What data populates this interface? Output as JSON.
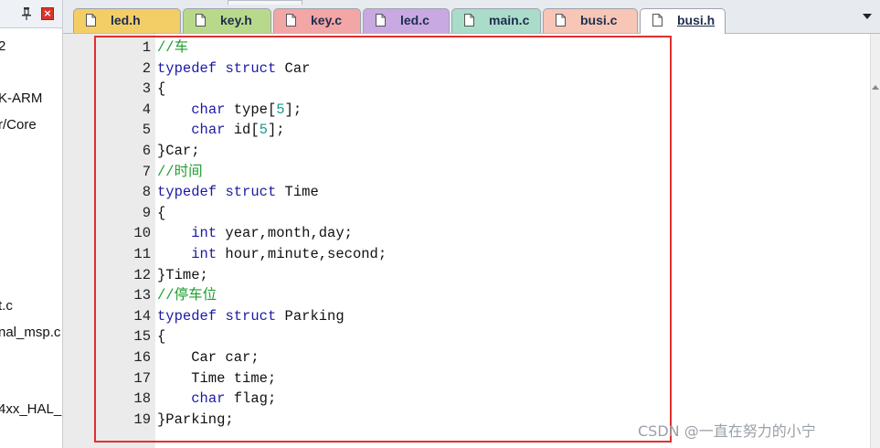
{
  "left_pane": {
    "items": [
      "2",
      "K-ARM",
      "r/Core",
      "t.c",
      "nal_msp.c",
      "4xx_HAL_"
    ]
  },
  "tabs": [
    {
      "label": "led.h",
      "color": "#f3ce67",
      "active": false
    },
    {
      "label": "key.h",
      "color": "#b9d98a",
      "active": false
    },
    {
      "label": "key.c",
      "color": "#f3a6a6",
      "active": false
    },
    {
      "label": "led.c",
      "color": "#c9a9e2",
      "active": false
    },
    {
      "label": "main.c",
      "color": "#a9dcc9",
      "active": false
    },
    {
      "label": "busi.c",
      "color": "#f7c6b6",
      "active": false
    },
    {
      "label": "busi.h",
      "color": "#ffffff",
      "active": true
    }
  ],
  "code_lines": [
    {
      "n": "1",
      "parts": [
        {
          "t": "//车",
          "c": "cmt"
        }
      ]
    },
    {
      "n": "2",
      "parts": [
        {
          "t": "typedef",
          "c": "kw"
        },
        {
          "t": " ",
          "c": ""
        },
        {
          "t": "struct",
          "c": "kw"
        },
        {
          "t": " Car",
          "c": ""
        }
      ]
    },
    {
      "n": "3",
      "parts": [
        {
          "t": "{",
          "c": ""
        }
      ]
    },
    {
      "n": "4",
      "parts": [
        {
          "t": "    ",
          "c": ""
        },
        {
          "t": "char",
          "c": "kw"
        },
        {
          "t": " type[",
          "c": ""
        },
        {
          "t": "5",
          "c": "num"
        },
        {
          "t": "];",
          "c": ""
        }
      ]
    },
    {
      "n": "5",
      "parts": [
        {
          "t": "    ",
          "c": ""
        },
        {
          "t": "char",
          "c": "kw"
        },
        {
          "t": " id[",
          "c": ""
        },
        {
          "t": "5",
          "c": "num"
        },
        {
          "t": "];",
          "c": ""
        }
      ]
    },
    {
      "n": "6",
      "parts": [
        {
          "t": "}Car;",
          "c": ""
        }
      ]
    },
    {
      "n": "7",
      "parts": [
        {
          "t": "//时间",
          "c": "cmt"
        }
      ]
    },
    {
      "n": "8",
      "parts": [
        {
          "t": "typedef",
          "c": "kw"
        },
        {
          "t": " ",
          "c": ""
        },
        {
          "t": "struct",
          "c": "kw"
        },
        {
          "t": " Time",
          "c": ""
        }
      ]
    },
    {
      "n": "9",
      "parts": [
        {
          "t": "{",
          "c": ""
        }
      ]
    },
    {
      "n": "10",
      "parts": [
        {
          "t": "    ",
          "c": ""
        },
        {
          "t": "int",
          "c": "kw"
        },
        {
          "t": " year,month,day;",
          "c": ""
        }
      ]
    },
    {
      "n": "11",
      "parts": [
        {
          "t": "    ",
          "c": ""
        },
        {
          "t": "int",
          "c": "kw"
        },
        {
          "t": " hour,minute,second;",
          "c": ""
        }
      ]
    },
    {
      "n": "12",
      "parts": [
        {
          "t": "}Time;",
          "c": ""
        }
      ]
    },
    {
      "n": "13",
      "parts": [
        {
          "t": "//停车位",
          "c": "cmt"
        }
      ]
    },
    {
      "n": "14",
      "parts": [
        {
          "t": "typedef",
          "c": "kw"
        },
        {
          "t": " ",
          "c": ""
        },
        {
          "t": "struct",
          "c": "kw"
        },
        {
          "t": " Parking",
          "c": ""
        }
      ]
    },
    {
      "n": "15",
      "parts": [
        {
          "t": "{",
          "c": ""
        }
      ]
    },
    {
      "n": "16",
      "parts": [
        {
          "t": "    Car car;",
          "c": ""
        }
      ]
    },
    {
      "n": "17",
      "parts": [
        {
          "t": "    Time time;",
          "c": ""
        }
      ]
    },
    {
      "n": "18",
      "parts": [
        {
          "t": "    ",
          "c": ""
        },
        {
          "t": "char",
          "c": "kw"
        },
        {
          "t": " flag;",
          "c": ""
        }
      ]
    },
    {
      "n": "19",
      "parts": [
        {
          "t": "}Parking;",
          "c": ""
        }
      ]
    }
  ],
  "watermark": "CSDN @一直在努力的小宁"
}
